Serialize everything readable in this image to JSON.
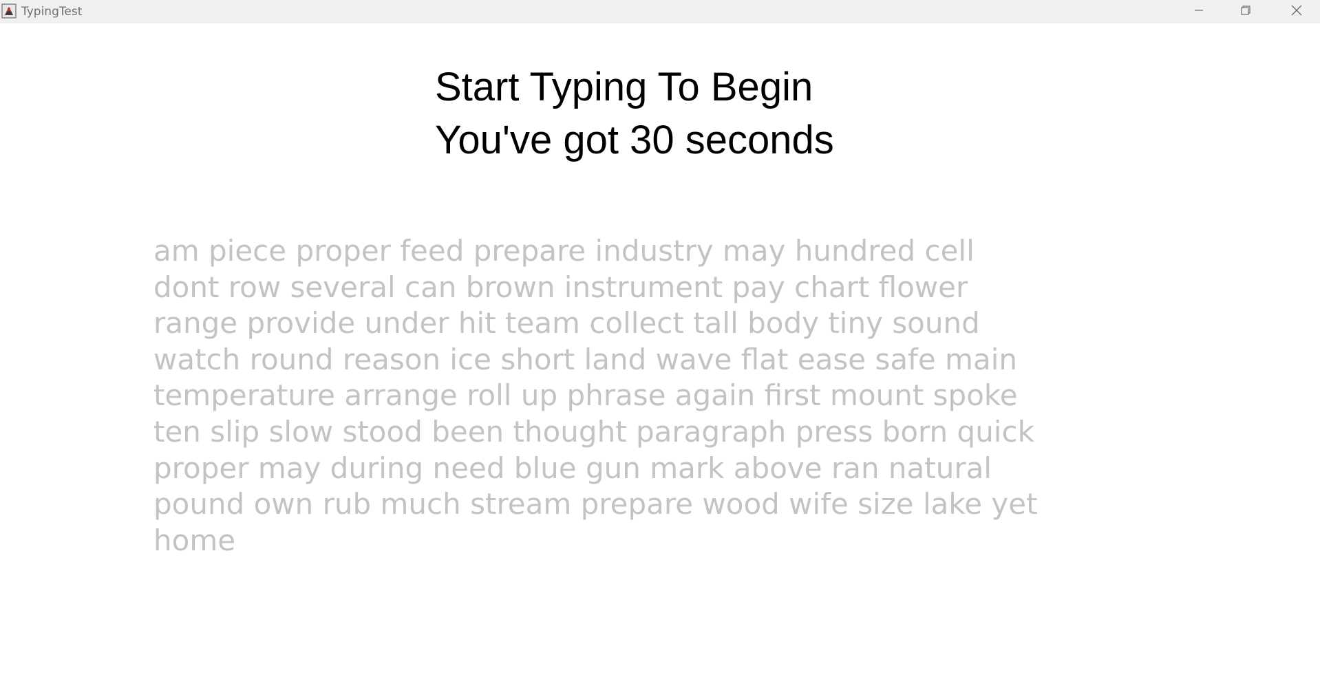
{
  "window": {
    "title": "TypingTest",
    "app_icon": "java-app-icon",
    "controls": {
      "minimize_icon": "minimize-icon",
      "maximize_icon": "restore-icon",
      "close_icon": "close-icon"
    }
  },
  "heading": {
    "line1": "Start Typing To Begin",
    "line2": "You've got 30 seconds"
  },
  "word_lines": [
    "am piece proper feed prepare industry may hundred cell",
    "dont row several can brown instrument pay chart flower",
    "range provide under hit team collect tall body tiny sound",
    "watch round reason ice short land wave flat ease safe main",
    "temperature arrange roll up phrase again first mount spoke",
    "ten slip slow stood been thought paragraph press born quick",
    "proper may during need blue gun mark above ran natural",
    "pound own rub much stream prepare wood wife size lake yet",
    "home"
  ],
  "colors": {
    "title_bar": "#f0f0f0",
    "title_text": "#6f6f6f",
    "heading_text": "#000000",
    "pending_word_text": "#c3c3c3",
    "background": "#ffffff"
  }
}
